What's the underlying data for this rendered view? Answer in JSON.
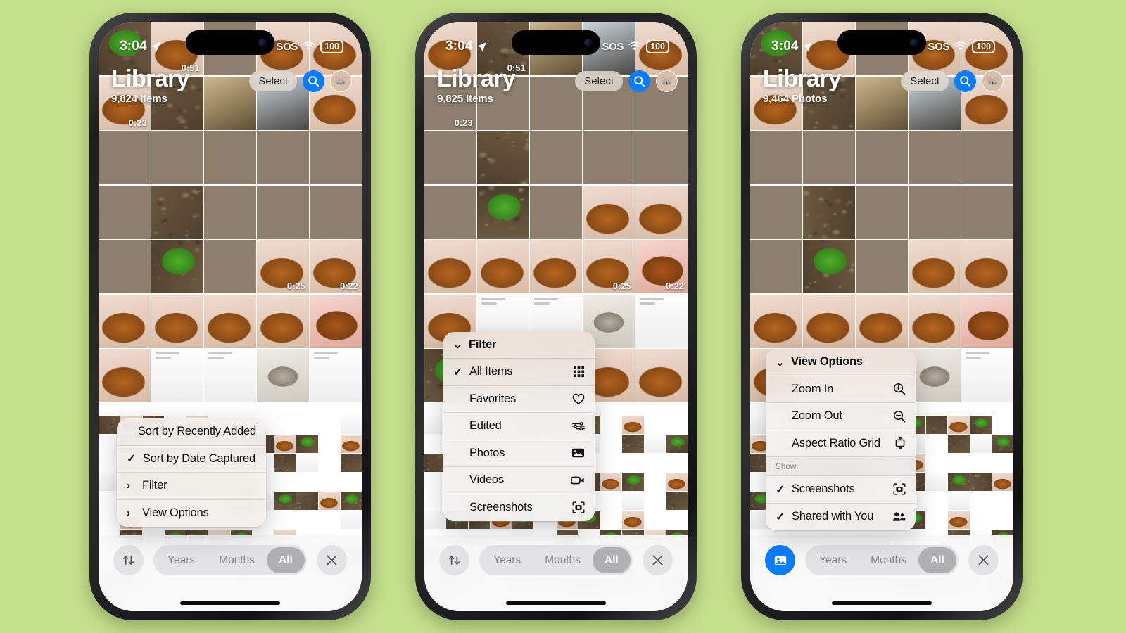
{
  "background_color": "#c5e08c",
  "accent_blue": "#0a7cff",
  "status_bar": {
    "time": "3:04",
    "location_icon": "location-arrow-icon",
    "sos": "SOS",
    "wifi_icon": "wifi-icon",
    "battery": "100"
  },
  "phones": [
    {
      "id": "phone-1",
      "header": {
        "title": "Library",
        "subtitle": "9,824 Items",
        "select_label": "Select",
        "search_icon": "search-icon",
        "avatar_icon": "avatar"
      },
      "menu": {
        "name": "sort-context-menu",
        "items": [
          {
            "label": "Sort by Recently Added",
            "tick": "",
            "chevron": "",
            "icon": ""
          },
          {
            "label": "Sort by Date Captured",
            "tick": "✓",
            "chevron": "",
            "icon": ""
          },
          {
            "label": "Filter",
            "tick": "",
            "chevron": "›",
            "icon": ""
          },
          {
            "label": "View Options",
            "tick": "",
            "chevron": "›",
            "icon": ""
          }
        ]
      },
      "toolbar": {
        "left_button": "sort-icon",
        "left_accent": false,
        "segments": [
          {
            "label": "Years",
            "active": false
          },
          {
            "label": "Months",
            "active": false
          },
          {
            "label": "All",
            "active": true
          }
        ],
        "close_label": "close-icon"
      },
      "video_durations": [
        "0:51",
        "0:23",
        "0:25",
        "0:22"
      ]
    },
    {
      "id": "phone-2",
      "header": {
        "title": "Library",
        "subtitle": "9,825 Items",
        "select_label": "Select",
        "search_icon": "search-icon",
        "avatar_icon": "avatar"
      },
      "menu": {
        "name": "filter-context-menu",
        "items": [
          {
            "label": "Filter",
            "tick": "",
            "chevron": "⌄",
            "icon": "",
            "header": true
          },
          {
            "label": "All Items",
            "tick": "✓",
            "chevron": "",
            "icon": "grid-icon"
          },
          {
            "label": "Favorites",
            "tick": "",
            "chevron": "",
            "icon": "heart-icon"
          },
          {
            "label": "Edited",
            "tick": "",
            "chevron": "",
            "icon": "sliders-icon"
          },
          {
            "label": "Photos",
            "tick": "",
            "chevron": "",
            "icon": "photo-icon"
          },
          {
            "label": "Videos",
            "tick": "",
            "chevron": "",
            "icon": "video-icon"
          },
          {
            "label": "Screenshots",
            "tick": "",
            "chevron": "",
            "icon": "screenshot-icon"
          }
        ]
      },
      "toolbar": {
        "left_button": "sort-icon",
        "left_accent": false,
        "segments": [
          {
            "label": "Years",
            "active": false
          },
          {
            "label": "Months",
            "active": false
          },
          {
            "label": "All",
            "active": true
          }
        ],
        "close_label": "close-icon"
      },
      "video_durations": [
        "0:51",
        "0:23",
        "0:25",
        "0:22"
      ]
    },
    {
      "id": "phone-3",
      "header": {
        "title": "Library",
        "subtitle": "9,464 Photos",
        "select_label": "Select",
        "search_icon": "search-icon",
        "avatar_icon": "avatar"
      },
      "menu": {
        "name": "view-options-context-menu",
        "items": [
          {
            "label": "View Options",
            "tick": "",
            "chevron": "⌄",
            "icon": "",
            "header": true
          },
          {
            "label": "Zoom In",
            "tick": "",
            "chevron": "",
            "icon": "zoom-in-icon"
          },
          {
            "label": "Zoom Out",
            "tick": "",
            "chevron": "",
            "icon": "zoom-out-icon"
          },
          {
            "label": "Aspect Ratio Grid",
            "tick": "",
            "chevron": "",
            "icon": "aspect-ratio-icon"
          },
          {
            "label": "Show:",
            "section": true
          },
          {
            "label": "Screenshots",
            "tick": "✓",
            "chevron": "",
            "icon": "screenshot-icon"
          },
          {
            "label": "Shared with You",
            "tick": "✓",
            "chevron": "",
            "icon": "shared-icon"
          }
        ]
      },
      "toolbar": {
        "left_button": "photo-filter-icon",
        "left_accent": true,
        "segments": [
          {
            "label": "Years",
            "active": false
          },
          {
            "label": "Months",
            "active": false
          },
          {
            "label": "All",
            "active": true
          }
        ],
        "close_label": "close-icon"
      },
      "video_durations": []
    }
  ]
}
